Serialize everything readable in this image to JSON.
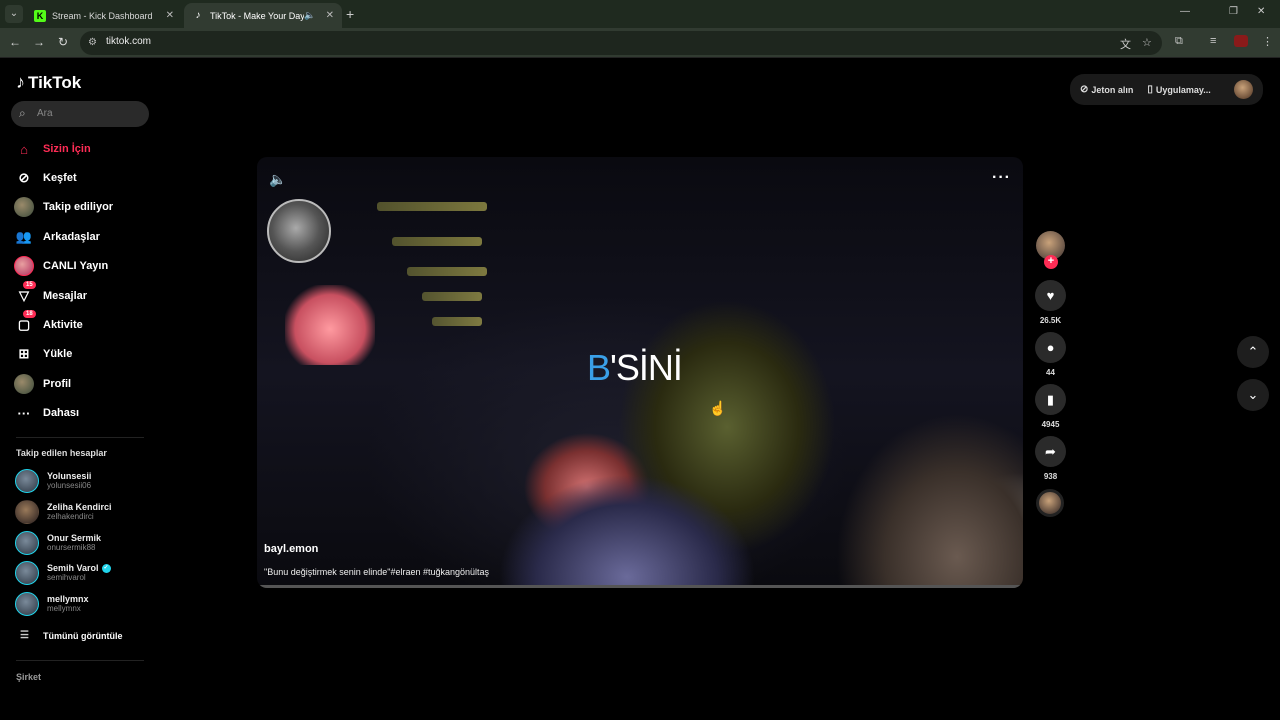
{
  "browser": {
    "tabs": [
      {
        "title": "Stream - Kick Dashboard",
        "favicon": "kick-icon"
      },
      {
        "title": "TikTok - Make Your Day",
        "favicon": "tiktok-icon"
      }
    ],
    "url": "tiktok.com"
  },
  "sidebar": {
    "logo": "TikTok",
    "search_placeholder": "Ara",
    "nav": [
      {
        "label": "Sizin İçin",
        "icon": "home-icon",
        "active": true
      },
      {
        "label": "Keşfet",
        "icon": "compass-icon"
      },
      {
        "label": "Takip ediliyor",
        "icon": "avatar"
      },
      {
        "label": "Arkadaşlar",
        "icon": "friends-icon"
      },
      {
        "label": "CANLI Yayın",
        "icon": "live-avatar"
      },
      {
        "label": "Mesajlar",
        "icon": "send-icon",
        "badge": "15"
      },
      {
        "label": "Aktivite",
        "icon": "activity-icon",
        "badge": "18"
      },
      {
        "label": "Yükle",
        "icon": "upload-icon"
      },
      {
        "label": "Profil",
        "icon": "avatar"
      },
      {
        "label": "Dahası",
        "icon": "more-icon"
      }
    ],
    "following_title": "Takip edilen hesaplar",
    "following": [
      {
        "name": "Yolunsesii",
        "user": "yolunsesii06"
      },
      {
        "name": "Zeliha Kendirci",
        "user": "zelhakendirci"
      },
      {
        "name": "Onur Sermik",
        "user": "onursermik88"
      },
      {
        "name": "Semih Varol",
        "user": "semihvarol",
        "verified": true
      },
      {
        "name": "mellymnx",
        "user": "mellymnx"
      }
    ],
    "see_all": "Tümünü görüntüle",
    "company": "Şirket"
  },
  "topbar": {
    "coins": "Jeton alın",
    "app": "Uygulamay..."
  },
  "video": {
    "caption_blue": "B",
    "caption_white": "'SİNİ",
    "author": "bayl.emon",
    "description": "\"Bunu değiştirmek senin elinde\"#elraen #tuğkangönültaş"
  },
  "actions": {
    "likes": "26.5K",
    "comments": "44",
    "saves": "4945",
    "shares": "938"
  },
  "colors": {
    "accent": "#fe2c55",
    "verified": "#20d5ec"
  }
}
